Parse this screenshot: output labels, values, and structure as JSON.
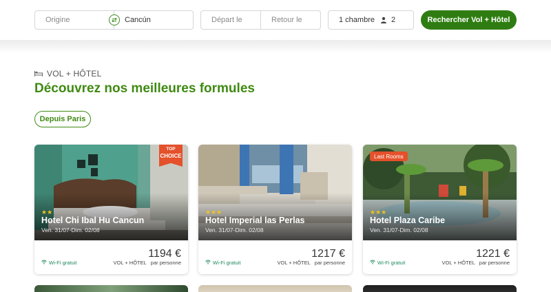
{
  "search": {
    "origin_placeholder": "Origine",
    "destination": "Cancún",
    "depart_placeholder": "Départ le",
    "return_placeholder": "Retour le",
    "rooms_label": "1 chambre",
    "guests_count": "2",
    "search_button": "Rechercher Vol + Hôtel"
  },
  "section": {
    "tag": "VOL + HÔTEL",
    "title": "Découvrez nos meilleures formules",
    "from_filter": "Depuis Paris"
  },
  "cards": [
    {
      "badge_line1": "TOP",
      "badge_line2": "CHOICE",
      "stars": "★★",
      "name": "Hotel Chi Ibal Hu Cancun",
      "dates": "Ven. 31/07-Dim. 02/08",
      "price": "1194 €",
      "wifi": "Wi-Fi gratuit",
      "formula": "VOL + HÔTEL",
      "per": "par personne"
    },
    {
      "stars": "★★★",
      "name": "Hotel Imperial las Perlas",
      "dates": "Ven. 31/07-Dim. 02/08",
      "price": "1217 €",
      "wifi": "Wi-Fi gratuit",
      "formula": "VOL + HÔTEL",
      "per": "par personne"
    },
    {
      "badge": "Last Rooms",
      "stars": "★★★",
      "name": "Hotel Plaza Caribe",
      "dates": "Ven. 31/07-Dim. 02/08",
      "price": "1221 €",
      "wifi": "Wi-Fi gratuit",
      "formula": "VOL + HÔTEL",
      "per": "par personne"
    }
  ],
  "colors": {
    "brand_green": "#2f7d12",
    "title_green": "#3f8a12",
    "badge_orange": "#e4512b",
    "star_gold": "#f2c21b",
    "wifi_green": "#1e8a5a"
  },
  "icons": [
    "swap-icon",
    "person-icon",
    "bed-icon",
    "wifi-icon"
  ]
}
